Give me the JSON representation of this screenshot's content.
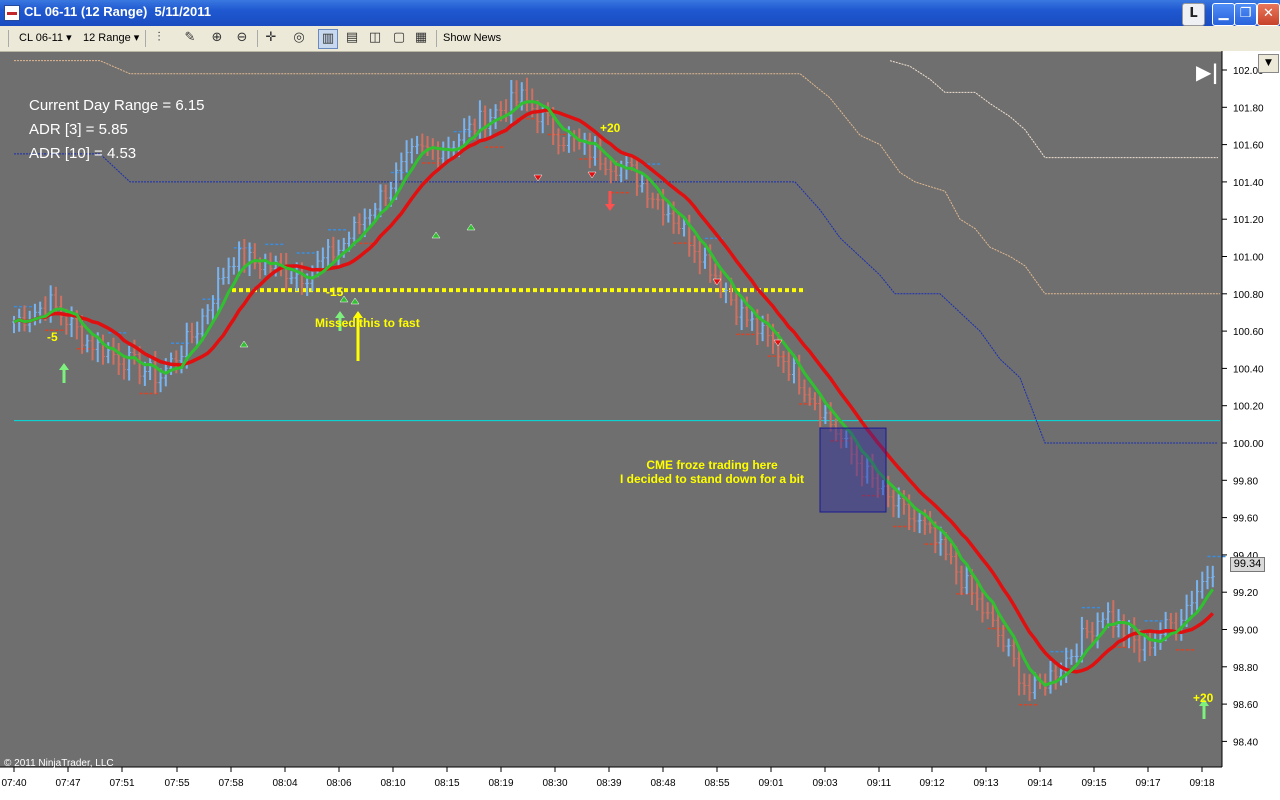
{
  "window": {
    "title": "CL 06-11 (12 Range)  5/11/2011",
    "controls": {
      "link": "L",
      "minimize": "▁",
      "maximize": "❐",
      "close": "✕"
    }
  },
  "toolbar": {
    "instrument": "CL 06-11",
    "period": "12 Range",
    "show_news": "Show News"
  },
  "stats": {
    "current_day_range": "Current Day Range = 6.15",
    "adr3": "ADR [3] = 5.85",
    "adr10": "ADR [10] = 4.53"
  },
  "annotations": {
    "missed": "Missed this to fast",
    "cme_line1": "CME froze trading here",
    "cme_line2": "I decided to stand down for a bit",
    "minus5": "-5",
    "minus15": "-15",
    "plus20_top": "+20",
    "plus20_bottom": "+20"
  },
  "copyright": "© 2011 NinjaTrader, LLC",
  "last_price": "99.34",
  "colors": {
    "background": "#6f6f6f",
    "up_bar": "#7ab4f0",
    "down_bar": "#d07060",
    "slow_ma": "#e01010",
    "fast_ma_up": "#30c030",
    "annotation": "#ffff00",
    "adr_upper": "#e0b890",
    "adr_lower": "#1a2fb0",
    "level_line": "#00e0e0"
  },
  "chart_data": {
    "type": "line",
    "title": "",
    "ylim": [
      98.3,
      102.05
    ],
    "y_ticks": [
      "102.00",
      "101.80",
      "101.60",
      "101.40",
      "101.20",
      "101.00",
      "100.80",
      "100.60",
      "100.40",
      "100.20",
      "100.00",
      "99.80",
      "99.60",
      "99.40",
      "99.20",
      "99.00",
      "98.80",
      "98.60",
      "98.40"
    ],
    "x_ticks": [
      "07:40",
      "07:47",
      "07:51",
      "07:55",
      "07:58",
      "08:04",
      "08:06",
      "08:10",
      "08:15",
      "08:19",
      "08:30",
      "08:39",
      "08:48",
      "08:55",
      "09:01",
      "09:03",
      "09:11",
      "09:12",
      "09:13",
      "09:14",
      "09:15",
      "09:17",
      "09:18"
    ],
    "series": [
      {
        "name": "",
        "values": [
          100.65,
          100.75,
          100.55,
          100.45,
          100.35,
          100.6,
          101.0,
          100.95,
          100.9,
          101.05,
          101.3,
          101.55,
          101.6,
          101.75,
          101.85,
          101.65,
          101.55,
          101.45,
          101.25,
          101.0,
          100.7,
          100.5,
          100.25,
          99.95,
          99.7,
          99.55,
          99.3,
          99.0,
          98.65,
          98.85,
          99.1,
          98.9,
          99.05,
          99.34
        ]
      }
    ],
    "levels": {
      "cyan": 100.12,
      "yellow_dotted": 100.82
    }
  }
}
